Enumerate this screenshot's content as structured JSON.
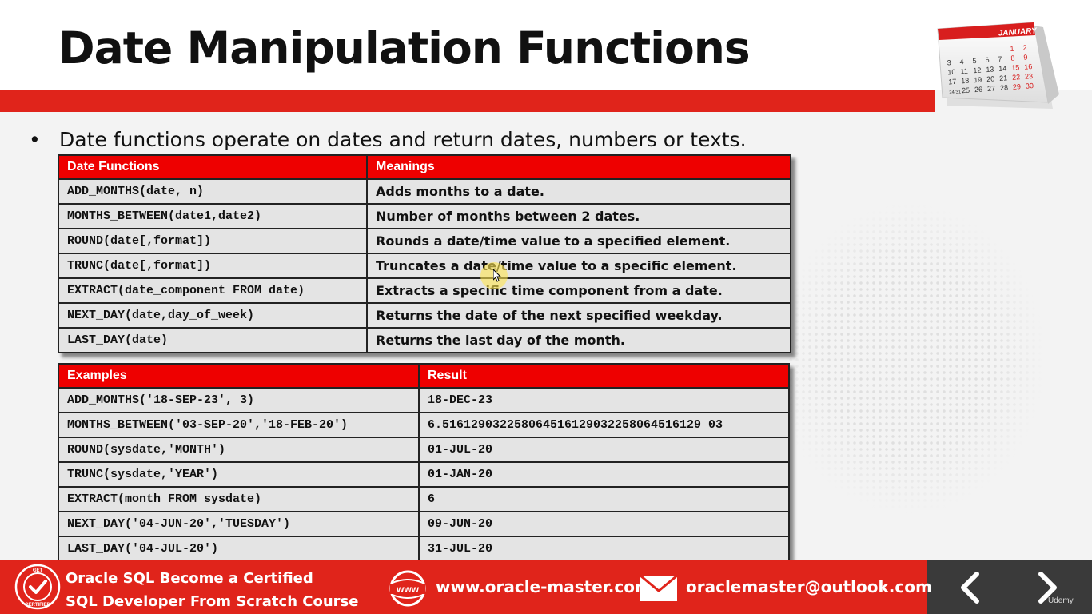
{
  "slide": {
    "title": "Date Manipulation Functions",
    "bullet_symbol": "•",
    "bullet_text": "Date functions operate on dates and return dates, numbers or texts."
  },
  "calendar": {
    "month": "JANUARY",
    "days": [
      [
        "",
        "",
        "",
        "",
        "",
        "1",
        "2"
      ],
      [
        "3",
        "4",
        "5",
        "6",
        "7",
        "8",
        "9"
      ],
      [
        "10",
        "11",
        "12",
        "13",
        "14",
        "15",
        "16"
      ],
      [
        "17",
        "18",
        "19",
        "20",
        "21",
        "22",
        "23"
      ],
      [
        "24/31",
        "25",
        "26",
        "27",
        "28",
        "29",
        "30"
      ]
    ]
  },
  "functions_table": {
    "headers": [
      "Date Functions",
      "Meanings"
    ],
    "rows": [
      [
        "ADD_MONTHS(date, n)",
        "Adds months to a date."
      ],
      [
        "MONTHS_BETWEEN(date1,date2)",
        "Number of months between 2 dates."
      ],
      [
        "ROUND(date[,format])",
        "Rounds a date/time value to a specified element."
      ],
      [
        "TRUNC(date[,format])",
        "Truncates a date/time value to a specific element."
      ],
      [
        "EXTRACT(date_component FROM date)",
        "Extracts a specific time component from a date."
      ],
      [
        "NEXT_DAY(date,day_of_week)",
        "Returns the date of the next specified weekday."
      ],
      [
        "LAST_DAY(date)",
        "Returns the last day of the month."
      ]
    ]
  },
  "examples_table": {
    "headers": [
      "Examples",
      "Result"
    ],
    "rows": [
      [
        "ADD_MONTHS('18-SEP-23', 3)",
        "18-DEC-23"
      ],
      [
        "MONTHS_BETWEEN('03-SEP-20','18-FEB-20')",
        "6.516129032258064516129032258064516129 03"
      ],
      [
        "ROUND(sysdate,'MONTH')",
        "01-JUL-20"
      ],
      [
        "TRUNC(sysdate,'YEAR')",
        "01-JAN-20"
      ],
      [
        "EXTRACT(month FROM sysdate)",
        "6"
      ],
      [
        "NEXT_DAY('04-JUN-20','TUESDAY')",
        "09-JUN-20"
      ],
      [
        "LAST_DAY('04-JUL-20')",
        "31-JUL-20"
      ]
    ]
  },
  "footer": {
    "badge_top": "GET",
    "badge_bottom": "CERTIFIED",
    "course_line1": "Oracle SQL Become a Certified",
    "course_line2": "SQL  Developer  From Scratch Course",
    "www_label": "www",
    "website": "www.oracle-master.com",
    "email": "oraclemaster@outlook.com",
    "watermark": "Udemy"
  },
  "colors": {
    "accent_red": "#e0241b",
    "header_red": "#ee0000",
    "cell_gray": "#e4e4e4",
    "nav_dark": "#3a3a3a"
  },
  "icons": {
    "calendar": "calendar-icon",
    "world_map": "world-map-decoration",
    "badge": "certified-badge-icon",
    "web": "globe-www-icon",
    "mail": "envelope-icon",
    "prev": "chevron-left-icon",
    "next": "chevron-right-icon",
    "cursor": "mouse-cursor-icon"
  }
}
